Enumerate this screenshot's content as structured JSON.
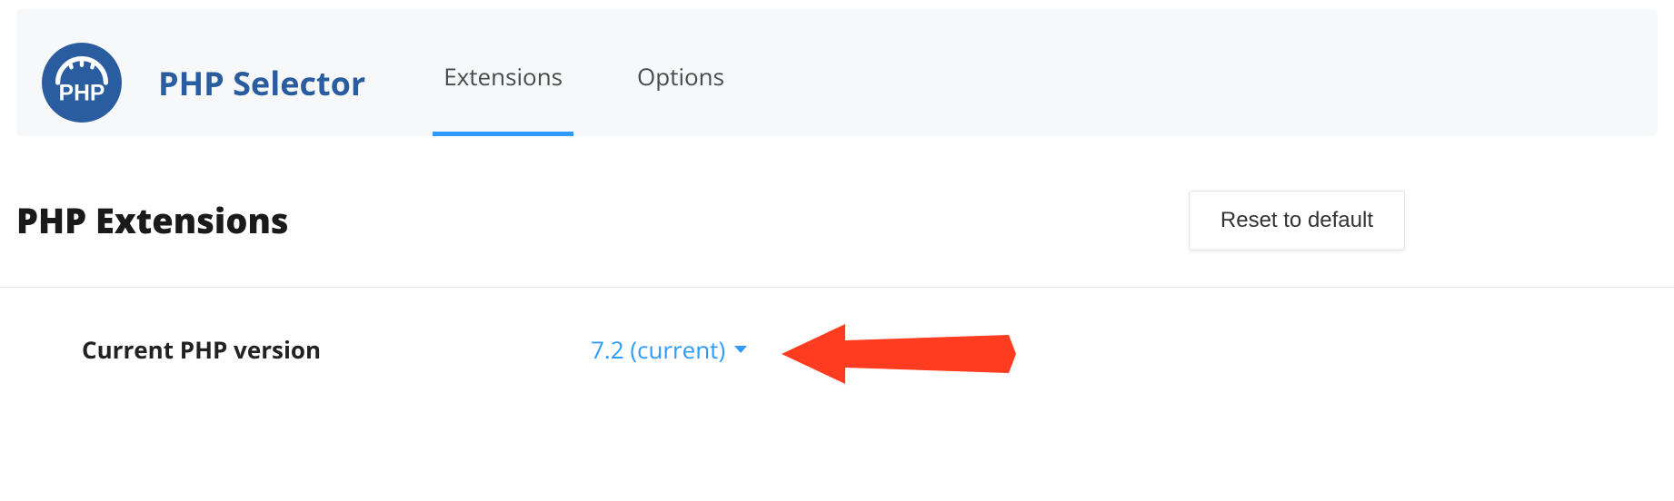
{
  "header": {
    "title": "PHP Selector",
    "tabs": [
      {
        "label": "Extensions",
        "active": true
      },
      {
        "label": "Options",
        "active": false
      }
    ],
    "icon_text": "PHP"
  },
  "section": {
    "title": "PHP Extensions",
    "reset_label": "Reset to default"
  },
  "version": {
    "label": "Current PHP version",
    "value": "7.2 (current)"
  }
}
